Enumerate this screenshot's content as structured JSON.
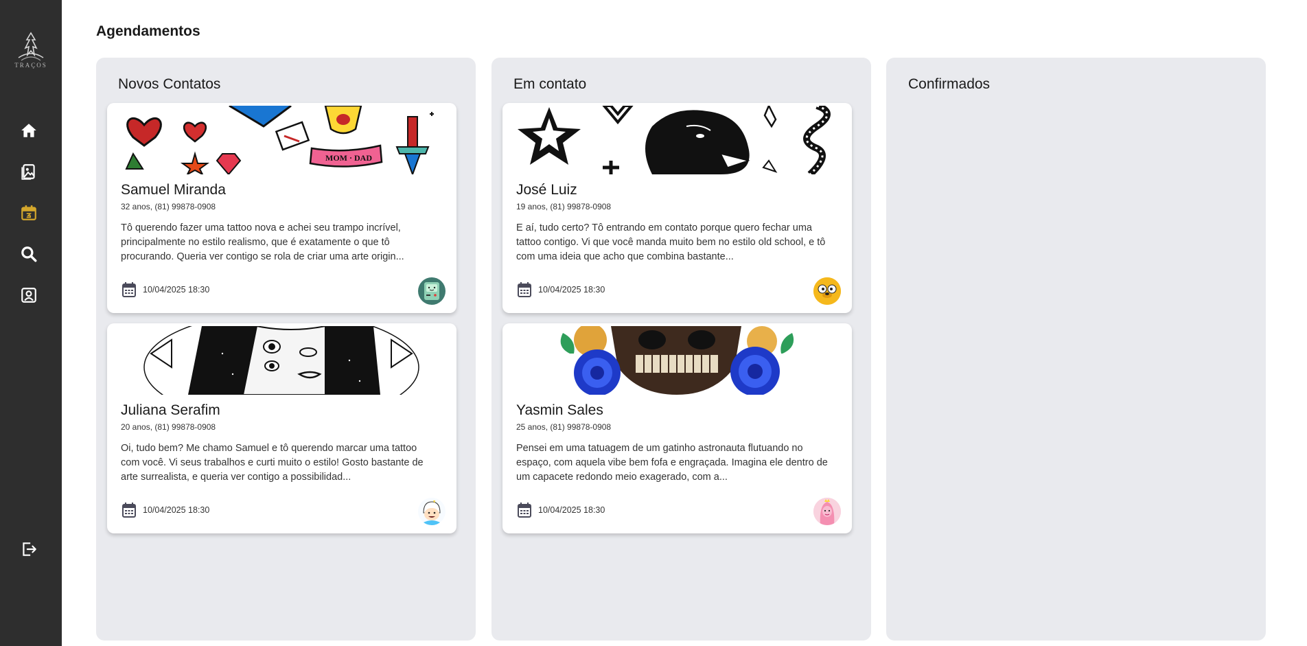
{
  "sidebar": {
    "logo_text": "TRAÇOS",
    "items": [
      {
        "icon": "home-icon",
        "active": false
      },
      {
        "icon": "gallery-icon",
        "active": false
      },
      {
        "icon": "calendar-icon",
        "active": true
      },
      {
        "icon": "search-icon",
        "active": false
      },
      {
        "icon": "profile-icon",
        "active": false
      }
    ],
    "logout_icon": "logout-icon",
    "colors": {
      "background": "#2e2e2e",
      "icon": "#ffffff",
      "active": "#d4a72c"
    }
  },
  "page": {
    "title": "Agendamentos"
  },
  "columns": [
    {
      "title": "Novos Contatos",
      "cards": [
        {
          "name": "Samuel Miranda",
          "meta": "32 anos, (81) 99878-0908",
          "message": "Tô querendo fazer uma tattoo nova e achei seu trampo incrível, principalmente no estilo realismo, que é exatamente o que tô procurando. Queria ver contigo se rola de criar uma arte origin...",
          "date": "10/04/2025 18:30",
          "image": "old-school-flash-tattoo-image",
          "avatar": "bmo-avatar"
        },
        {
          "name": "Juliana Serafim",
          "meta": "20 anos, (81) 99878-0908",
          "message": "Oi, tudo bem? Me chamo Samuel e tô querendo marcar uma tattoo com você. Vi seus trabalhos e curti muito o estilo! Gosto bastante de arte surrealista, e queria ver contigo a possibilidad...",
          "date": "10/04/2025 18:30",
          "image": "surreal-face-tattoo-image",
          "avatar": "finn-avatar"
        }
      ]
    },
    {
      "title": "Em contato",
      "cards": [
        {
          "name": "José Luiz",
          "meta": "19 anos, (81) 99878-0908",
          "message": "E aí, tudo certo? Tô entrando em contato porque quero fechar uma tattoo contigo. Vi que você manda muito bem no estilo old school, e tô com uma ideia que acho que combina bastante...",
          "date": "10/04/2025 18:30",
          "image": "blackwork-panther-tattoo-image",
          "avatar": "jake-avatar"
        },
        {
          "name": "Yasmin Sales",
          "meta": "25 anos, (81) 99878-0908",
          "message": "Pensei em uma tatuagem de um gatinho astronauta flutuando no espaço, com aquela vibe bem fofa e engraçada. Imagina ele dentro de um capacete redondo meio exagerado, com a...",
          "date": "10/04/2025 18:30",
          "image": "skull-roses-tattoo-image",
          "avatar": "princess-bubblegum-avatar"
        }
      ]
    },
    {
      "title": "Confirmados",
      "cards": []
    }
  ]
}
